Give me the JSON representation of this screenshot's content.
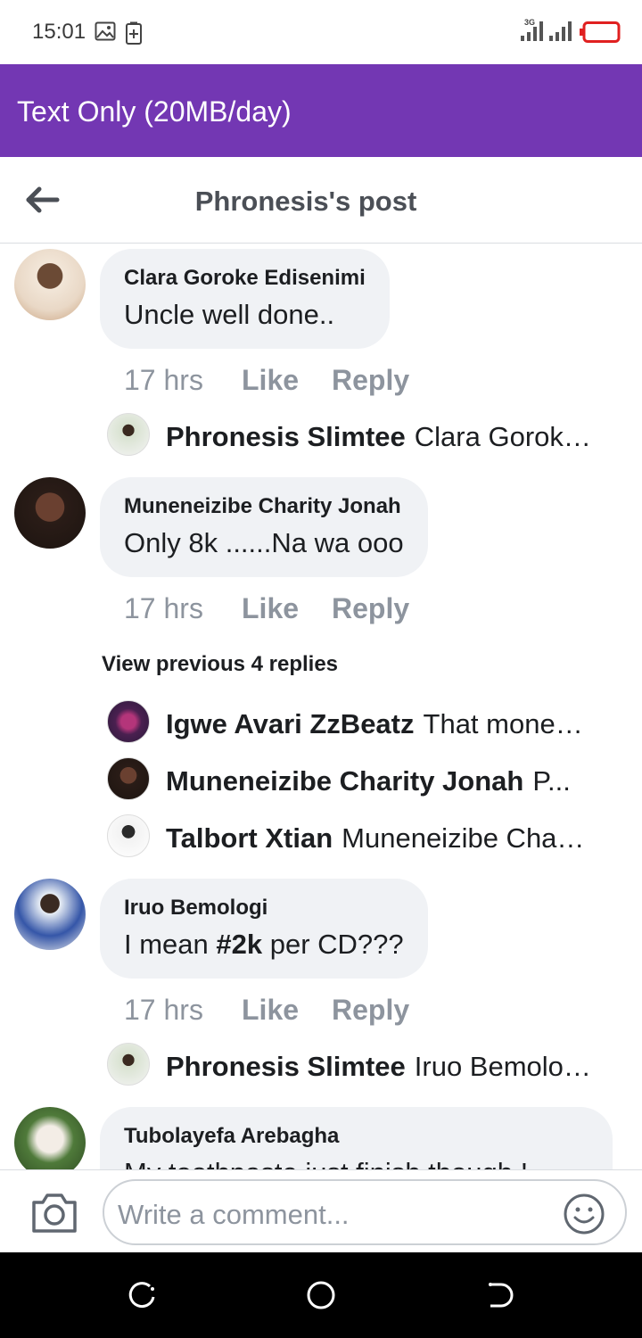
{
  "status_bar": {
    "time": "15:01",
    "gallery_icon": "image-icon",
    "battery_saver_icon": "battery-plus-icon",
    "network_label": "3G",
    "battery_color": "#e02020"
  },
  "banner": {
    "text": "Text Only (20MB/day)",
    "color": "#7337b3"
  },
  "header": {
    "title": "Phronesis's post",
    "back_icon": "back-arrow-icon"
  },
  "comments": [
    {
      "name": "Clara Goroke Edisenimi",
      "text": "Uncle well done..",
      "time": "17 hrs",
      "like": "Like",
      "reply": "Reply",
      "replies": [
        {
          "name": "Phronesis Slimtee",
          "text": "Clara Goroke Edisenimi ..."
        }
      ]
    },
    {
      "name": "Muneneizibe Charity Jonah",
      "text": "Only 8k ......Na wa ooo",
      "time": "17 hrs",
      "like": "Like",
      "reply": "Reply",
      "view_previous": "View previous 4 replies",
      "replies": [
        {
          "name": "Igwe Avari ZzBeatz",
          "text": "That money ..."
        },
        {
          "name": "Muneneizibe Charity Jonah",
          "text": "P..."
        },
        {
          "name": "Talbort Xtian",
          "text": "Muneneizibe Charity ..."
        }
      ]
    },
    {
      "name": "Iruo Bemologi",
      "text_prefix": "I mean ",
      "text_bold": "#2k",
      "text_suffix": " per CD???",
      "time": "17 hrs",
      "like": "Like",
      "reply": "Reply",
      "replies": [
        {
          "name": "Phronesis Slimtee",
          "text": "Iruo Bemologi ..."
        }
      ]
    },
    {
      "name": "Tubolayefa Arebagha",
      "text": "My toothpaste just finish though !"
    }
  ],
  "composer": {
    "placeholder": "Write a comment...",
    "camera_icon": "camera-icon",
    "emoji_icon": "emoji-icon"
  },
  "navbar": {
    "recent_icon": "recent-apps-icon",
    "home_icon": "home-icon",
    "back_icon": "back-icon"
  }
}
